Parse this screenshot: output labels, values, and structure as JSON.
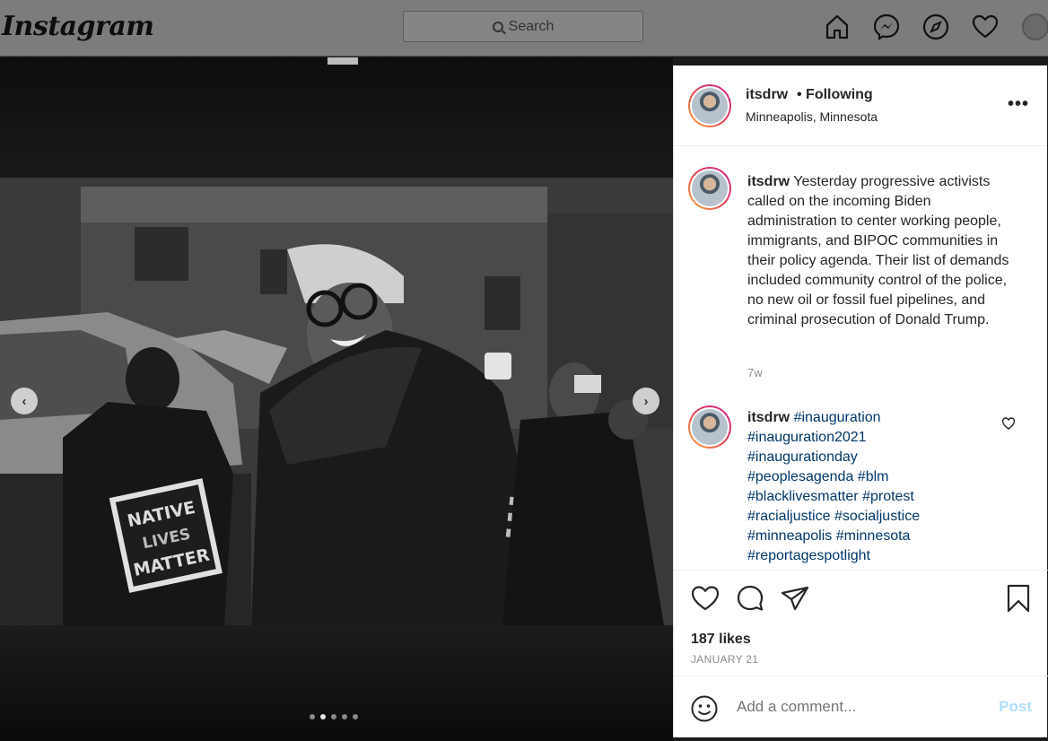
{
  "header": {
    "logo": "Instagram",
    "search_placeholder": "Search",
    "nav_icons": [
      "home-icon",
      "messenger-icon",
      "explore-icon",
      "heart-icon",
      "avatar"
    ]
  },
  "post": {
    "username": "itsdrw",
    "follow_status": "• Following",
    "location": "Minneapolis, Minnesota",
    "more": "•••",
    "caption": {
      "username": "itsdrw",
      "text": "Yesterday progressive activists called on the incoming Biden administration to center working people, immigrants, and BIPOC communities in their policy agenda. Their list of demands included community control of the police, no new oil or fossil fuel pipelines, and criminal prosecution of Donald Trump.",
      "time": "7w"
    },
    "comment": {
      "username": "itsdrw",
      "hashtags": [
        "#inauguration",
        "#inauguration2021",
        "#inaugurationday",
        "#peoplesagenda",
        "#blm",
        "#blacklivesmatter",
        "#protest",
        "#racialjustice",
        "#socialjustice",
        "#minneapolis",
        "#minnesota",
        "#reportagespotlight"
      ]
    },
    "likes": "187 likes",
    "date": "JANUARY 21",
    "comment_placeholder": "Add a comment...",
    "post_button": "Post"
  },
  "photo": {
    "sign_text": [
      "NATIVE",
      "LIVES",
      "MATTER"
    ],
    "carousel_count": 5,
    "carousel_active": 2
  }
}
